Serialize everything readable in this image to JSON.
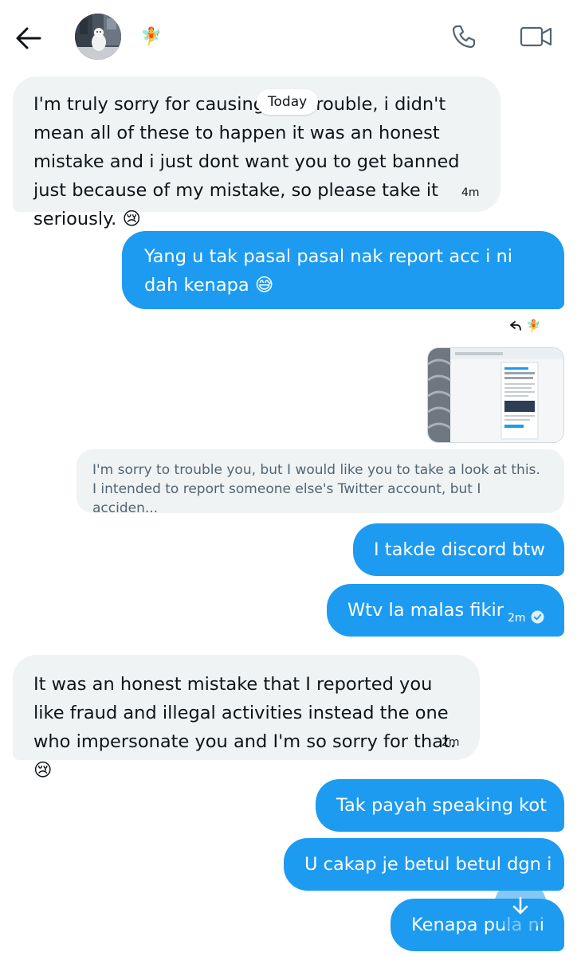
{
  "header": {
    "back_icon": "arrow-left-icon",
    "contact_emoji": "🧚",
    "call_icon": "phone-icon",
    "video_icon": "video-camera-icon"
  },
  "date_divider": "Today",
  "messages": [
    {
      "from": "them",
      "text": "I'm truly sorry for causing this trouble, i didn't mean all of these to happen it was an honest mistake and i just dont want you to get banned just because of my mistake, so please take it seriously. 😢",
      "time": "4m"
    },
    {
      "from": "me",
      "text": "Yang u tak pasal pasal nak report acc i ni dah kenapa 😅"
    },
    {
      "from": "me",
      "text": "I takde discord btw"
    },
    {
      "from": "me",
      "text": "Wtv la malas fikir",
      "time": "2m"
    },
    {
      "from": "them",
      "text": "It was an honest mistake that I reported you like fraud and illegal activities  instead the one who impersonate you and I'm so sorry for that.😢",
      "time": "2m"
    },
    {
      "from": "me",
      "text": "Tak payah speaking kot"
    },
    {
      "from": "me",
      "text": "U cakap je betul betul dgn i"
    },
    {
      "from": "me",
      "text": "Kenapa pula ni"
    }
  ],
  "reply": {
    "emoji": "🧚",
    "quote_text": "I'm sorry to trouble you, but I would like you to take a look at this. I intended to report someone else's Twitter account, but I acciden..."
  },
  "status": {
    "read_icon": "check-circle-icon"
  },
  "scroll_button": {
    "icon": "arrow-down-icon"
  },
  "colors": {
    "outgoing_bubble": "#1d9bf0",
    "incoming_bubble": "#eff3f4",
    "text": "#0f1419",
    "muted": "#536471"
  }
}
